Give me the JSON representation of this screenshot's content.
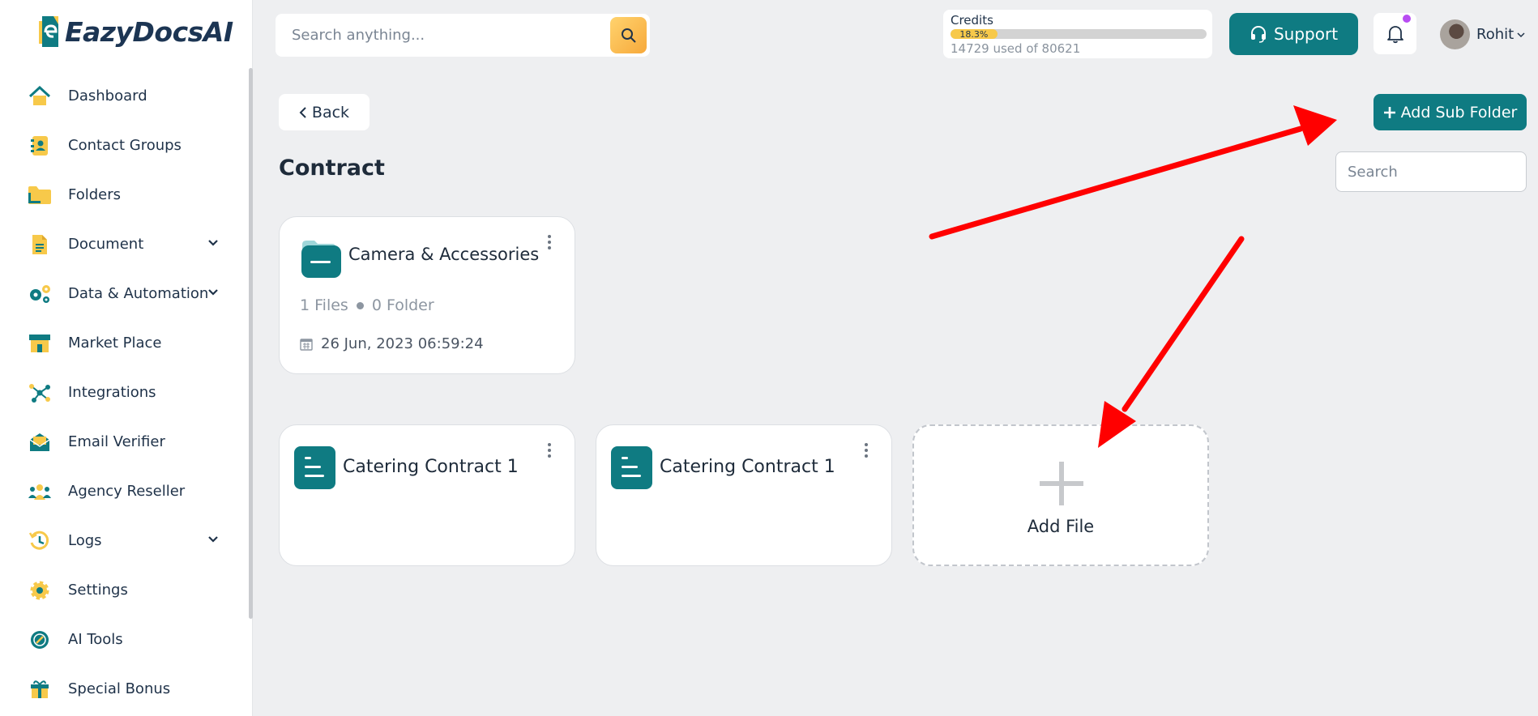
{
  "app": {
    "name": "EazyDocsAI"
  },
  "sidebar": {
    "items": [
      {
        "label": "Dashboard",
        "icon": "home-icon",
        "expandable": false
      },
      {
        "label": "Contact Groups",
        "icon": "contact-book-icon",
        "expandable": false
      },
      {
        "label": "Folders",
        "icon": "folder-icon",
        "expandable": false
      },
      {
        "label": "Document",
        "icon": "document-icon",
        "expandable": true
      },
      {
        "label": "Data & Automation",
        "icon": "gears-icon",
        "expandable": true
      },
      {
        "label": "Market Place",
        "icon": "store-icon",
        "expandable": false
      },
      {
        "label": "Integrations",
        "icon": "integrations-icon",
        "expandable": false
      },
      {
        "label": "Email Verifier",
        "icon": "email-verifier-icon",
        "expandable": false
      },
      {
        "label": "Agency Reseller",
        "icon": "agency-icon",
        "expandable": false
      },
      {
        "label": "Logs",
        "icon": "history-icon",
        "expandable": true
      },
      {
        "label": "Settings",
        "icon": "gear-icon",
        "expandable": false
      },
      {
        "label": "AI Tools",
        "icon": "ai-tools-icon",
        "expandable": false
      },
      {
        "label": "Special Bonus",
        "icon": "gift-icon",
        "expandable": false
      }
    ]
  },
  "header": {
    "search_placeholder": "Search anything...",
    "credits": {
      "title": "Credits",
      "percent_label": "18.3%",
      "percent": 18.3,
      "usage": "14729 used of 80621"
    },
    "support_label": "Support",
    "user_name": "Rohit"
  },
  "main": {
    "back_label": "Back",
    "add_sub_folder_label": "Add Sub Folder",
    "search_placeholder": "Search",
    "title": "Contract",
    "folder": {
      "name": "Camera & Accessories",
      "files": "1 Files",
      "folders": "0 Folder",
      "date": "26 Jun, 2023 06:59:24"
    },
    "files": [
      {
        "name": "Catering Contract 1"
      },
      {
        "name": "Catering Contract 1"
      }
    ],
    "add_file_label": "Add File"
  },
  "colors": {
    "brand_teal": "#0f7b82",
    "accent_yellow": "#f7c94a",
    "annotation_red": "#ff0000"
  }
}
